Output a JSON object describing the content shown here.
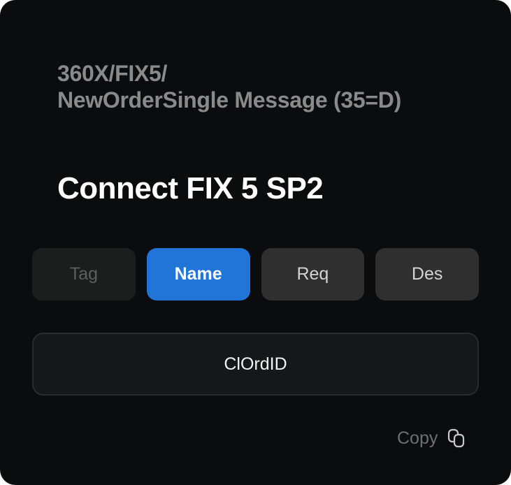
{
  "breadcrumb": {
    "line1": "360X/FIX5/",
    "line2": "NewOrderSingle Message (35=D)"
  },
  "title": "Connect FIX 5 SP2",
  "tabs": [
    {
      "label": "Tag",
      "state": "disabled"
    },
    {
      "label": "Name",
      "state": "active"
    },
    {
      "label": "Req",
      "state": "normal"
    },
    {
      "label": "Des",
      "state": "normal"
    }
  ],
  "field_value": "ClOrdID",
  "copy": {
    "label": "Copy",
    "icon": "copy-icon"
  },
  "colors": {
    "card_background": "#0b0c0e",
    "accent": "#2174d8",
    "muted_text": "#8a8a8a"
  }
}
